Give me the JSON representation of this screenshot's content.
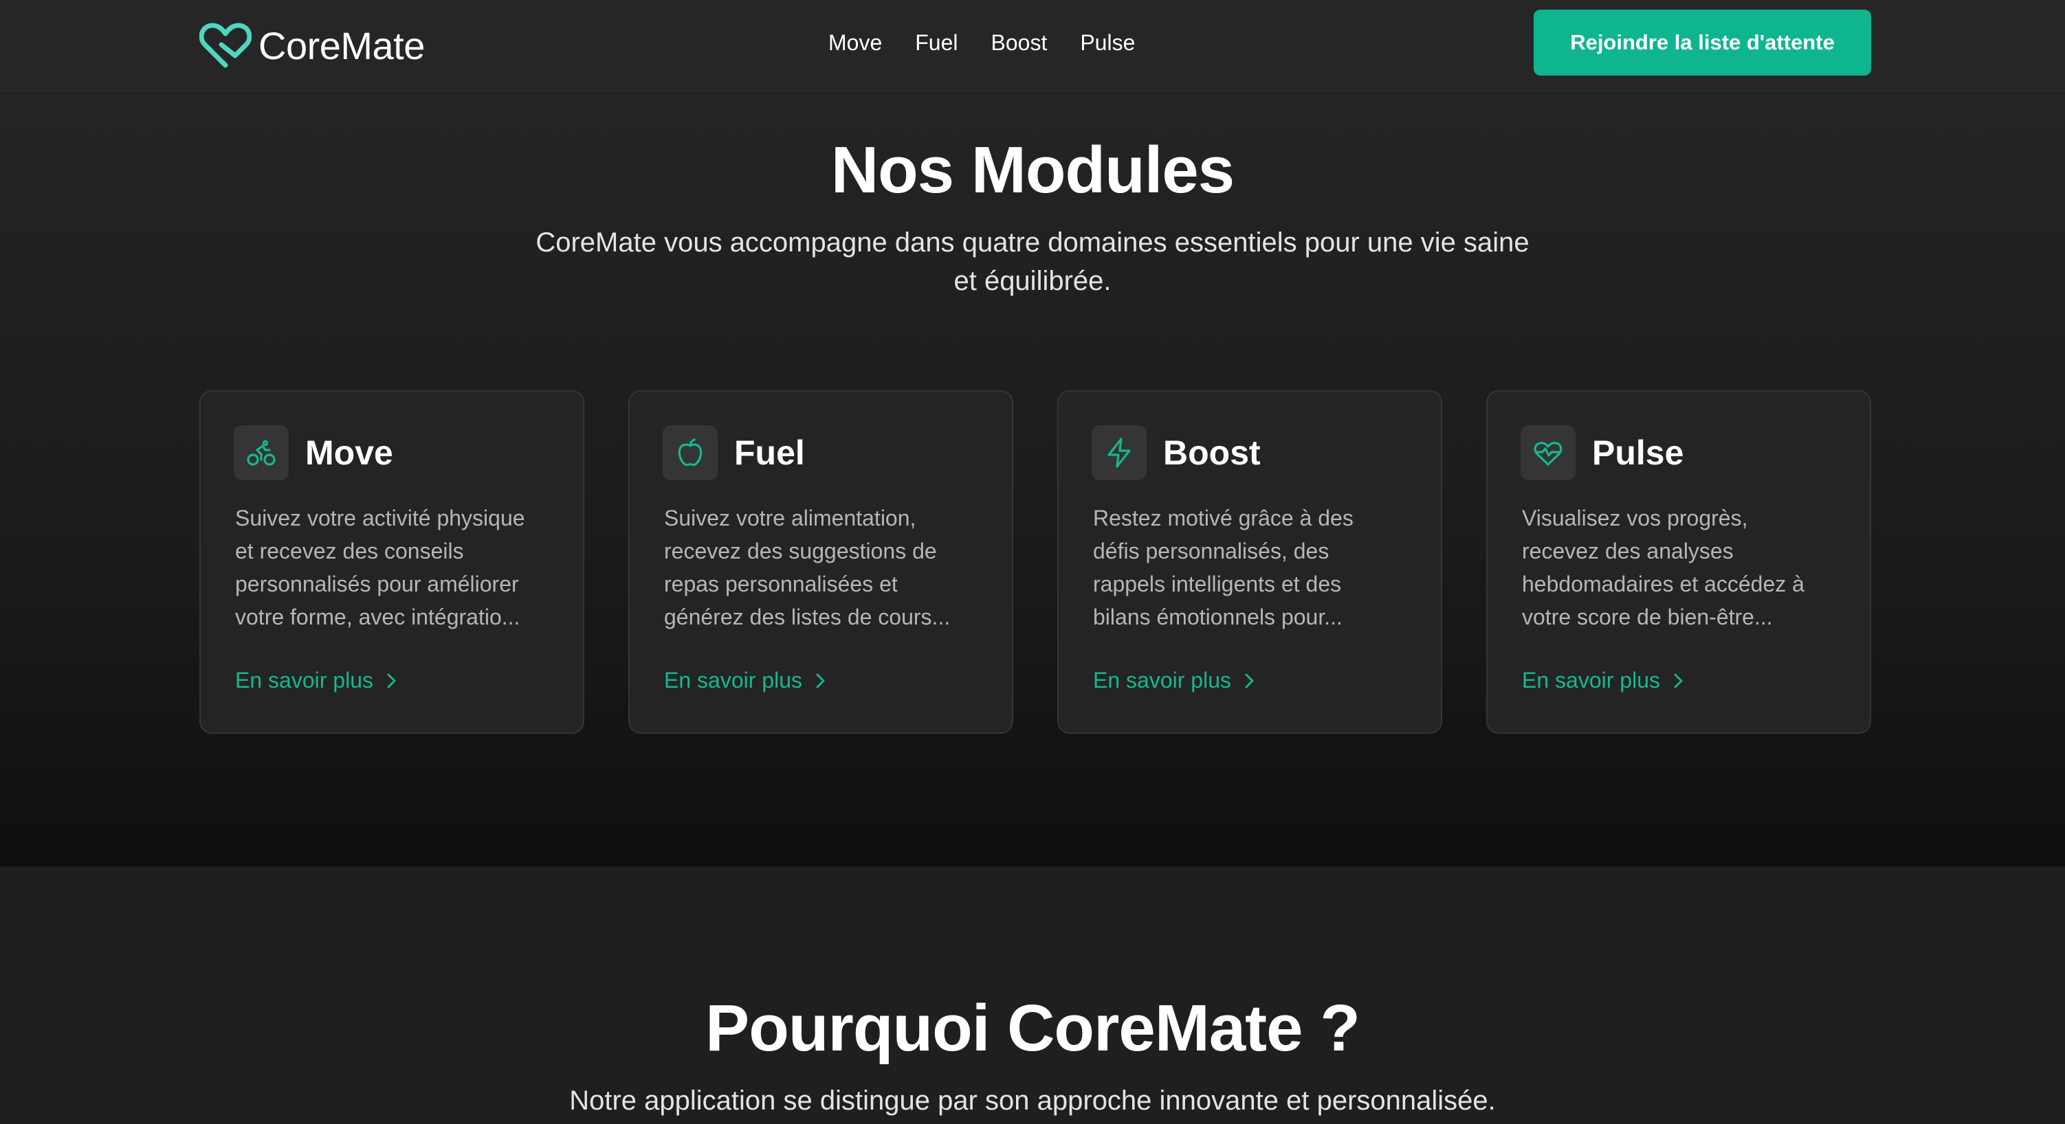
{
  "header": {
    "brand": "CoreMate",
    "nav": [
      "Move",
      "Fuel",
      "Boost",
      "Pulse"
    ],
    "cta_label": "Rejoindre la liste d'attente"
  },
  "modules": {
    "title": "Nos Modules",
    "subtitle_lines": [
      "CoreMate vous accompagne dans quatre domaines essentiels pour une vie saine",
      "et équilibrée."
    ],
    "cards": [
      {
        "title": "Move",
        "icon": "bike-icon",
        "desc_lines": [
          "Suivez votre activité physique",
          "et recevez des conseils",
          "personnalisés pour améliorer",
          "votre forme, avec intégratio..."
        ],
        "link_label": "En savoir plus"
      },
      {
        "title": "Fuel",
        "icon": "apple-icon",
        "desc_lines": [
          "Suivez votre alimentation,",
          "recevez des suggestions de",
          "repas personnalisées et",
          "générez des listes de cours..."
        ],
        "link_label": "En savoir plus"
      },
      {
        "title": "Boost",
        "icon": "lightning-icon",
        "desc_lines": [
          "Restez motivé grâce à des",
          "défis personnalisés, des",
          "rappels intelligents et des",
          "bilans émotionnels pour..."
        ],
        "link_label": "En savoir plus"
      },
      {
        "title": "Pulse",
        "icon": "heart-pulse-icon",
        "desc_lines": [
          "Visualisez vos progrès,",
          "recevez des analyses",
          "hebdomadaires et accédez à",
          "votre score de bien-être..."
        ],
        "link_label": "En savoir plus"
      }
    ]
  },
  "why": {
    "title": "Pourquoi CoreMate ?",
    "subtitle": "Notre application se distingue par son approche innovante et personnalisée."
  },
  "colors": {
    "accent": "#0fb58f",
    "link": "#14b88e",
    "background": "#1e1e1e",
    "card": "#242424"
  }
}
